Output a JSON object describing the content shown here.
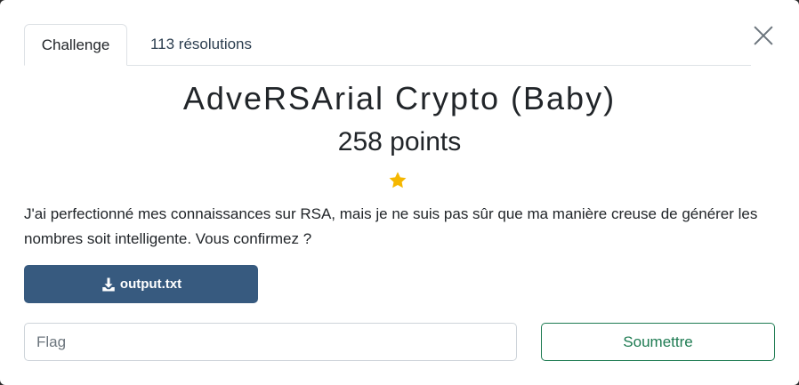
{
  "tabs": [
    {
      "label": "Challenge",
      "active": true
    },
    {
      "label": "113 résolutions",
      "active": false
    }
  ],
  "challenge": {
    "title": "AdveRSArial Crypto (Baby)",
    "points": "258 points",
    "rating_icon": "star-icon",
    "description": "J'ai perfectionné mes connaissances sur RSA, mais je ne suis pas sûr que ma manière creuse de générer les nombres soit intelligente. Vous confirmez ?"
  },
  "file": {
    "label": "output.txt",
    "icon": "download-icon"
  },
  "flag_input": {
    "placeholder": "Flag",
    "value": ""
  },
  "submit_label": "Soumettre",
  "colors": {
    "download_button": "#375a7f",
    "submit_accent": "#1e7b52",
    "star": "#f5b700"
  }
}
